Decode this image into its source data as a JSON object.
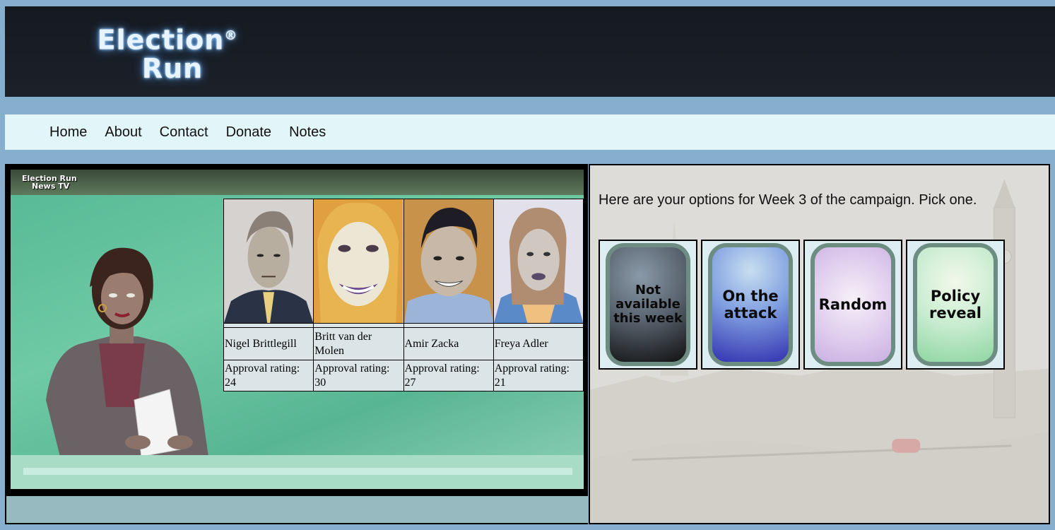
{
  "header": {
    "logo_line1": "Election",
    "logo_reg": "®",
    "logo_line2": "Run"
  },
  "nav": {
    "items": [
      "Home",
      "About",
      "Contact",
      "Donate",
      "Notes"
    ]
  },
  "news": {
    "channel_line1": "Election Run",
    "channel_line2": "News TV",
    "candidates": [
      {
        "name": "Nigel Brittlegill",
        "rating": "Approval rating: 24"
      },
      {
        "name": "Britt van der Molen",
        "rating": "Approval rating: 30"
      },
      {
        "name": "Amir Zacka",
        "rating": "Approval rating: 27"
      },
      {
        "name": "Freya Adler",
        "rating": "Approval rating: 21"
      }
    ]
  },
  "options": {
    "prompt": "Here are your options for Week 3 of the campaign. Pick one.",
    "cards": [
      {
        "label": "Not available this week",
        "color": "#101010"
      },
      {
        "label": "On the attack",
        "color": "#3333b0"
      },
      {
        "label": "Random",
        "color": "#c9b0e2"
      },
      {
        "label": "Policy reveal",
        "color": "#8fd6a2"
      }
    ]
  },
  "colors": {
    "page_bg": "#86aecd",
    "header_bg": "#151920",
    "nav_bg": "#e2f5f8",
    "tv_green": "#6fcaa5",
    "table_cell": "#dbe5e8",
    "footer_bar": "#97b9c0"
  }
}
